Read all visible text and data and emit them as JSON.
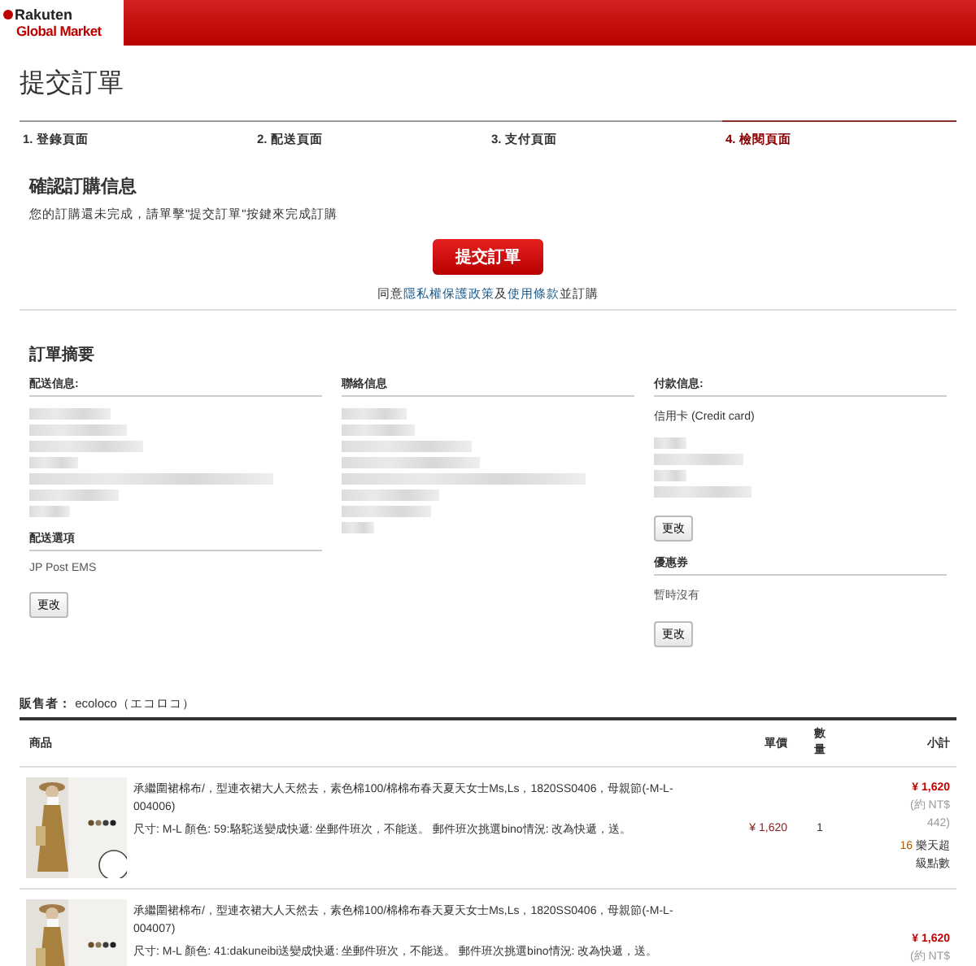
{
  "header": {
    "logo_top": "Rakuten",
    "logo_bottom": "Global Market"
  },
  "page_title": "提交訂單",
  "steps": [
    {
      "label": "1. 登錄頁面",
      "selected": false
    },
    {
      "label": "2. 配送頁面",
      "selected": false
    },
    {
      "label": "3. 支付頁面",
      "selected": false
    },
    {
      "label": "4. 檢閱頁面",
      "selected": true
    }
  ],
  "confirm": {
    "heading": "確認訂購信息",
    "message": "您的訂購還未完成，請單擊\"提交訂單\"按鍵來完成訂購",
    "submit_button": "提交訂單",
    "agree_prefix": "同意",
    "privacy_link": "隱私權保護政策",
    "agree_and": "及",
    "terms_link": "使用條款",
    "agree_suffix": "並訂購"
  },
  "summary": {
    "heading": "訂單摘要",
    "shipping": {
      "title": "配送信息:",
      "option_title": "配送選項",
      "option_value": "JP Post EMS",
      "change_button": "更改"
    },
    "contact": {
      "title": "聯絡信息"
    },
    "payment": {
      "title": "付款信息:",
      "method": "信用卡 (Credit card)",
      "change_button": "更改",
      "coupon_title": "優惠券",
      "coupon_value": "暫時沒有",
      "coupon_button": "更改"
    }
  },
  "seller": {
    "label": "販售者：",
    "name": "ecoloco（エコロコ）"
  },
  "table": {
    "columns": [
      "商品",
      "單價",
      "數量",
      "小計"
    ],
    "rows": [
      {
        "title": "承繼圍裙棉布/，型連衣裙大人天然去，素色棉100/棉棉布春天夏天女士Ms,Ls，1820SS0406，母親節(-M-L-004006)",
        "options": "尺寸: M-L 顏色: 59:駱駝送變成快遞: 坐郵件班次，不能送。 郵件班次挑選bino情況: 改為快遞，送。",
        "price": "¥ 1,620",
        "qty": "1",
        "subtotal": "¥ 1,620",
        "approx": "(約 NT$ 442)",
        "points": "16",
        "points_label": "樂天超級點數"
      },
      {
        "title": "承繼圍裙棉布/，型連衣裙大人天然去，素色棉100/棉棉布春天夏天女士Ms,Ls，1820SS0406，母親節(-M-L-004007)",
        "options": "尺寸: M-L 顏色: 41:dakuneibi送變成快遞: 坐郵件班次，不能送。 郵件班次挑選bino情況: 改為快遞，送。",
        "subtotal": "¥ 1,620",
        "approx": "(約 NT$"
      }
    ]
  }
}
